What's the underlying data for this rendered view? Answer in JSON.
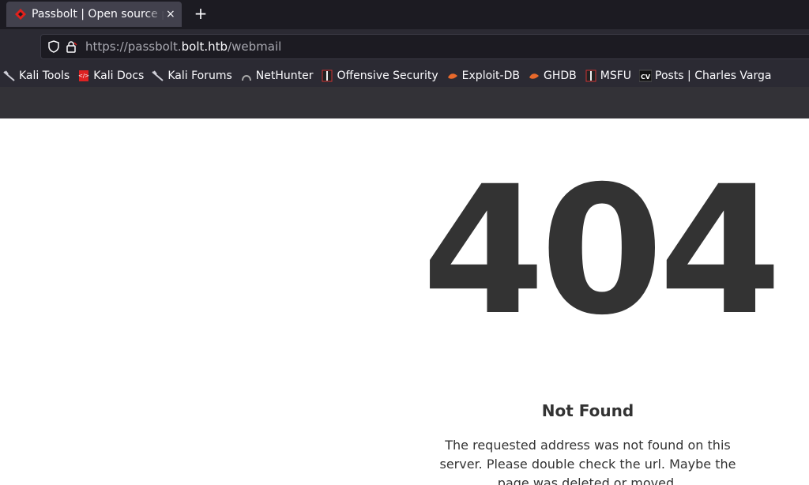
{
  "browser": {
    "tab": {
      "title": "Passbolt | Open source password manager for teams",
      "icon": "passbolt-favicon"
    },
    "new_tab_label": "+",
    "close_label": "×",
    "url": {
      "prefix": "https://passbolt.",
      "host": "bolt.htb",
      "path": "/webmail"
    }
  },
  "bookmarks": [
    {
      "label": "Kali Tools",
      "icon": "kali-dragon-icon"
    },
    {
      "label": "Kali Docs",
      "icon": "kali-docs-icon"
    },
    {
      "label": "Kali Forums",
      "icon": "kali-dragon-icon"
    },
    {
      "label": "NetHunter",
      "icon": "nethunter-icon"
    },
    {
      "label": "Offensive Security",
      "icon": "offsec-icon"
    },
    {
      "label": "Exploit-DB",
      "icon": "exploit-db-icon"
    },
    {
      "label": "GHDB",
      "icon": "ghdb-icon"
    },
    {
      "label": "MSFU",
      "icon": "offsec-icon"
    },
    {
      "label": "Posts | Charles Varga",
      "icon": "cv-icon"
    }
  ],
  "error_page": {
    "code": "404",
    "title": "Not Found",
    "message": "The requested address was not found on this server. Please double check the url. Maybe the page was deleted or moved."
  },
  "colors": {
    "tab_bar": "#1c1b22",
    "toolbar": "#2b2a33",
    "text_dark": "#333333",
    "passbolt_red": "#e2211c"
  }
}
